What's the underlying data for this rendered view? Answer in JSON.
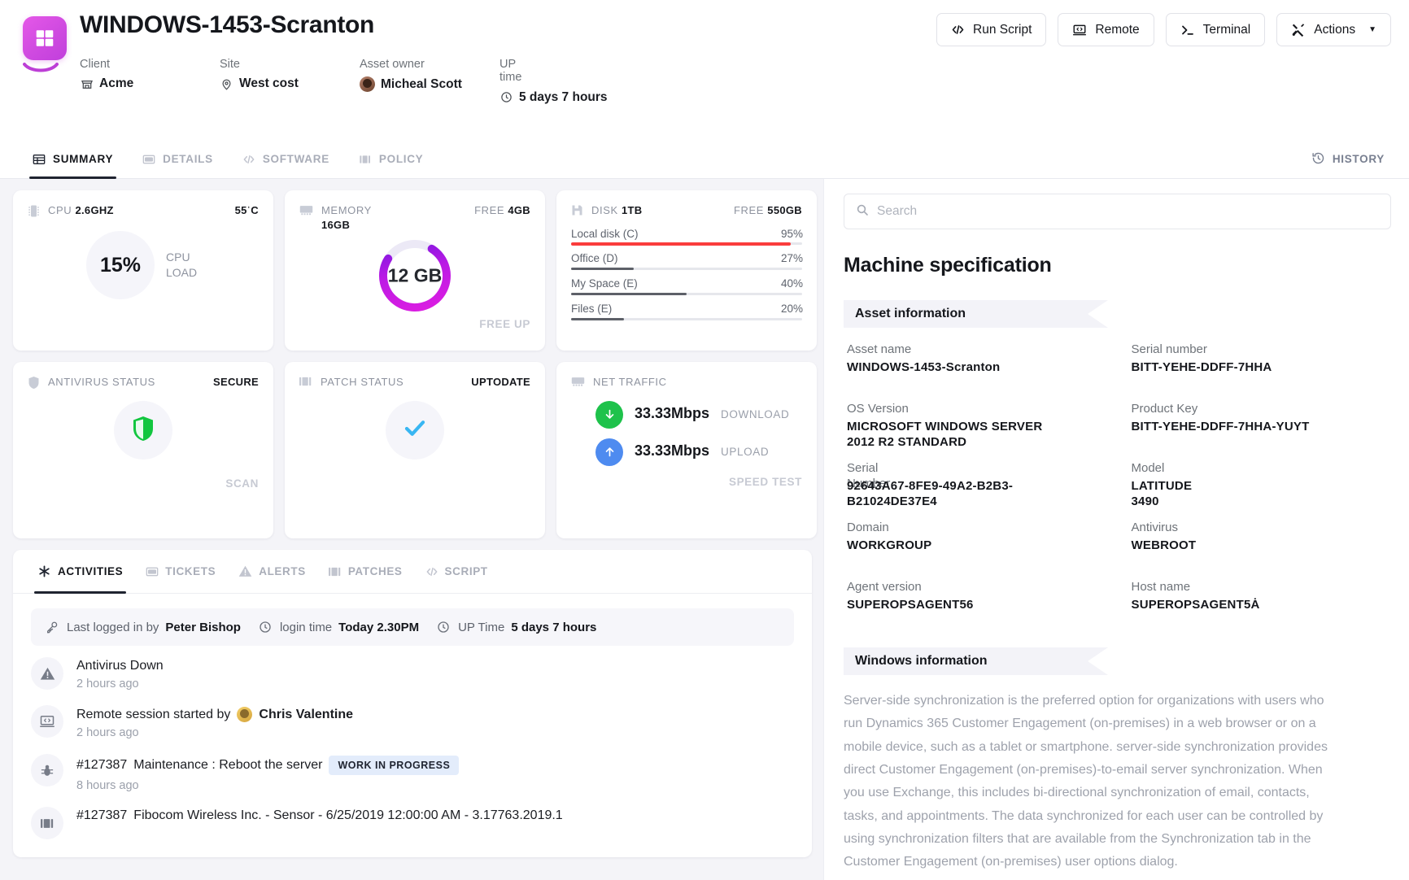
{
  "header": {
    "logo_icon": "windows-logo-icon",
    "title": "WINDOWS-1453-Scranton",
    "meta": [
      {
        "label": "Client",
        "value": "Acme",
        "icon": "store-icon"
      },
      {
        "label": "Site",
        "value": "West cost",
        "icon": "location-pin-icon"
      },
      {
        "label": "Asset owner",
        "value": "Micheal Scott",
        "icon": "avatar-icon"
      },
      {
        "label": "UP time",
        "value": "5 days 7 hours",
        "icon": "clock-icon"
      }
    ],
    "actions": [
      {
        "label": "Run Script",
        "icon": "code-icon"
      },
      {
        "label": "Remote",
        "icon": "remote-desktop-icon"
      },
      {
        "label": "Terminal",
        "icon": "terminal-icon"
      },
      {
        "label": "Actions",
        "icon": "tools-icon",
        "caret": "▼"
      }
    ]
  },
  "tabs": [
    {
      "label": "SUMMARY",
      "icon": "summary-icon",
      "active": true
    },
    {
      "label": "DETAILS",
      "icon": "details-icon",
      "active": false
    },
    {
      "label": "SOFTWARE",
      "icon": "code-icon",
      "active": false
    },
    {
      "label": "POLICY",
      "icon": "policy-icon",
      "active": false
    }
  ],
  "history": {
    "label": "HISTORY",
    "icon": "history-clock-icon"
  },
  "cards": {
    "cpu": {
      "title_prefix": "CPU",
      "title_value": "2.6GHZ",
      "temperature": "55ˈC",
      "load_percent": "15%",
      "load_caption": "CPU LOAD",
      "icon": "cpu-chip-icon"
    },
    "memory": {
      "title_prefix": "MEMORY",
      "title_value": "16GB",
      "free_label": "FREE",
      "free_value": "4GB",
      "used_value": "12 GB",
      "used_fraction": 0.75,
      "footer": "FREE UP",
      "icon": "memory-ram-icon",
      "gradient_from": "#e21ee2",
      "gradient_to": "#6d17e0"
    },
    "disk": {
      "title_prefix": "DISK",
      "title_value": "1TB",
      "free_label": "FREE",
      "free_value": "550GB",
      "icon": "floppy-disk-icon",
      "volumes": [
        {
          "name": "Local disk (C)",
          "percent": "95%",
          "value": 95,
          "critical": true
        },
        {
          "name": "Office (D)",
          "percent": "27%",
          "value": 27,
          "critical": false
        },
        {
          "name": "My Space (E)",
          "percent": "40%",
          "value": 40,
          "critical": false
        },
        {
          "name": "Files (E)",
          "percent": "20%",
          "value": 20,
          "critical": false
        }
      ],
      "critical_color": "#fa3c3c",
      "normal_color": "#5d6068"
    },
    "antivirus": {
      "title": "ANTIVIRUS STATUS",
      "status": "SECURE",
      "footer": "SCAN",
      "icon": "shield-icon",
      "status_icon": "shield-filled-icon",
      "status_color": "#1ec24b"
    },
    "patch": {
      "title": "PATCH STATUS",
      "status": "UPTODATE",
      "icon": "patch-icon",
      "status_icon": "checkmark-icon",
      "status_color": "#38b6f2"
    },
    "net": {
      "title": "NET TRAFFIC",
      "icon": "network-icon",
      "download": {
        "speed": "33.33Mbps",
        "label": "DOWNLOAD",
        "icon": "arrow-down-icon",
        "color": "#1ec24b"
      },
      "upload": {
        "speed": "33.33Mbps",
        "label": "UPLOAD",
        "icon": "arrow-up-icon",
        "color": "#4e8bf0"
      },
      "footer": "SPEED TEST"
    }
  },
  "activities": {
    "tabs": [
      {
        "label": "ACTIVITIES",
        "icon": "asterisk-icon",
        "active": true
      },
      {
        "label": "TICKETS",
        "icon": "ticket-icon",
        "active": false
      },
      {
        "label": "ALERTS",
        "icon": "warning-triangle-icon",
        "active": false
      },
      {
        "label": "PATCHES",
        "icon": "patch-icon",
        "active": false
      },
      {
        "label": "SCRIPT",
        "icon": "code-icon",
        "active": false
      }
    ],
    "login_bar": {
      "logged_in_label": "Last logged in by",
      "logged_in_user": "Peter Bishop",
      "login_time_label": "login time",
      "login_time_value": "Today 2.30PM",
      "uptime_label": "UP Time",
      "uptime_value": "5 days 7 hours"
    },
    "items": [
      {
        "icon": "warning-triangle-icon",
        "title": "Antivirus Down",
        "time": "2 hours ago",
        "badge": null,
        "user": null,
        "id": null
      },
      {
        "icon": "remote-desktop-icon",
        "title": "Remote session started by",
        "time": "2 hours ago",
        "badge": null,
        "user": "Chris Valentine",
        "id": null
      },
      {
        "icon": "bug-icon",
        "title": "Maintenance : Reboot the server",
        "time": "8 hours ago",
        "badge": "WORK IN PROGRESS",
        "user": null,
        "id": "#127387"
      },
      {
        "icon": "patch-icon",
        "title": "Fibocom Wireless Inc. - Sensor - 6/25/2019 12:00:00 AM - 3.17763.2019.1",
        "time": null,
        "badge": null,
        "user": null,
        "id": "#127387"
      }
    ]
  },
  "right_panel": {
    "search": {
      "placeholder": "Search",
      "value": "",
      "icon": "search-icon"
    },
    "heading": "Machine specification",
    "asset_section_title": "Asset information",
    "asset_fields": [
      {
        "label": "Asset name",
        "value": "WINDOWS-1453-Scranton"
      },
      {
        "label": "Serial number",
        "value": "BITT-YEHE-DDFF-7HHA"
      },
      {
        "label": "OS Version",
        "value": "MICROSOFT WINDOWS SERVER 2012 R2 STANDARD"
      },
      {
        "label": "Product Key",
        "value": "BITT-YEHE-DDFF-7HHA-YUYT"
      },
      {
        "label": "Serial Number",
        "value": "92643A67-8FE9-49A2-B2B3-B21024DE37E4"
      },
      {
        "label": "Model",
        "value": "LATITUDE 3490"
      },
      {
        "label": "Domain",
        "value": "WORKGROUP"
      },
      {
        "label": "Antivirus",
        "value": "WEBROOT"
      },
      {
        "label": "Agent version",
        "value": "SUPEROPSAGENT56"
      },
      {
        "label": "Host name",
        "value": "SUPEROPSAGENT5Ȧ"
      }
    ],
    "windows_section_title": "Windows information",
    "windows_text": "Server-side synchronization is the preferred option for organizations with users who run Dynamics 365 Customer Engagement (on-premises) in a web browser or on a mobile device, such as a tablet or smartphone. server-side synchronization provides direct Customer Engagement (on-premises)-to-email server synchronization. When you use Exchange, this includes bi-directional synchronization of email, contacts, tasks, and appointments. The data synchronized for each user can be controlled by using synchronization filters that are available from the Synchronization tab in the Customer Engagement (on-premises) user options dialog."
  }
}
